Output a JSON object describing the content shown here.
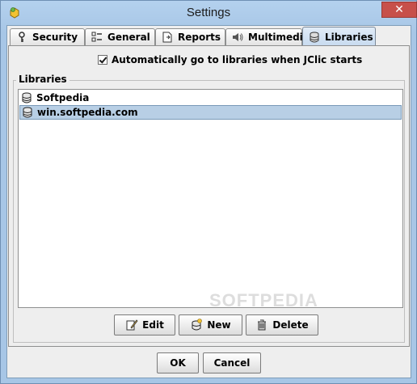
{
  "window": {
    "title": "Settings",
    "close_symbol": "✕"
  },
  "tabs": [
    {
      "label": "Security",
      "icon": "key-icon",
      "active": false
    },
    {
      "label": "General",
      "icon": "settings-list-icon",
      "active": false
    },
    {
      "label": "Reports",
      "icon": "report-icon",
      "active": false
    },
    {
      "label": "Multimedia",
      "icon": "speaker-icon",
      "active": false
    },
    {
      "label": "Libraries",
      "icon": "database-icon",
      "active": true
    }
  ],
  "libraries_tab": {
    "auto_checkbox": {
      "label": "Automatically go to libraries when JClic starts",
      "checked": true
    },
    "group_label": "Libraries",
    "items": [
      {
        "label": "Softpedia",
        "selected": false
      },
      {
        "label": "win.softpedia.com",
        "selected": true
      }
    ],
    "buttons": {
      "edit": "Edit",
      "new": "New",
      "delete": "Delete"
    }
  },
  "footer": {
    "ok": "OK",
    "cancel": "Cancel"
  },
  "watermark": "SOFTPEDIA",
  "colors": {
    "selection": "#b8cfe5",
    "title_bar": "#a7c6e6",
    "close_button": "#c7504a"
  }
}
